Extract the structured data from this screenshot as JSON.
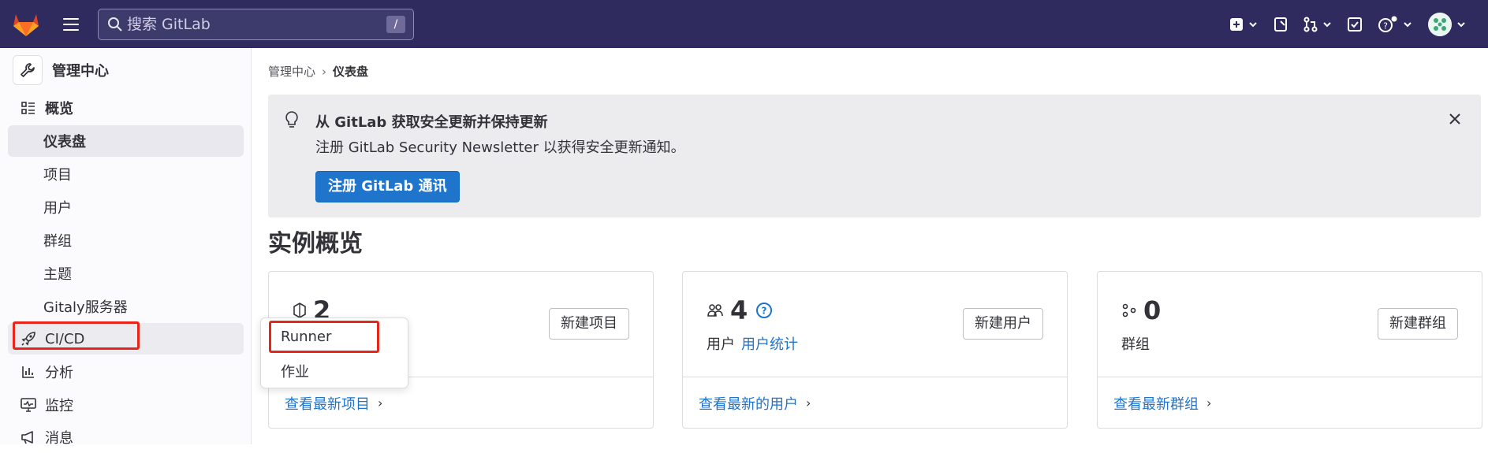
{
  "topbar": {
    "search_placeholder": "搜索 GitLab",
    "search_shortcut": "/",
    "icons": [
      "plus-square-icon",
      "issues-icon",
      "merge-request-icon",
      "todo-icon",
      "help-icon",
      "user-avatar"
    ]
  },
  "sidebar": {
    "title": "管理中心",
    "items": [
      {
        "label": "概览",
        "icon": "overview-icon"
      },
      {
        "label": "仪表盘"
      },
      {
        "label": "项目"
      },
      {
        "label": "用户"
      },
      {
        "label": "群组"
      },
      {
        "label": "主题"
      },
      {
        "label": "Gitaly服务器"
      },
      {
        "label": "CI/CD",
        "icon": "rocket-icon"
      },
      {
        "label": "分析",
        "icon": "chart-icon"
      },
      {
        "label": "监控",
        "icon": "monitor-icon"
      },
      {
        "label": "消息",
        "icon": "bullhorn-icon"
      }
    ]
  },
  "flyout": {
    "items": [
      "Runner",
      "作业"
    ]
  },
  "breadcrumb": {
    "parent": "管理中心",
    "current": "仪表盘"
  },
  "banner": {
    "title": "从 GitLab 获取安全更新并保持更新",
    "description": "注册 GitLab Security Newsletter 以获得安全更新通知。",
    "button": "注册 GitLab 通讯"
  },
  "section_title": "实例概览",
  "cards": [
    {
      "count": "2",
      "label": "",
      "link": "",
      "button": "新建项目",
      "footer": "查看最新项目"
    },
    {
      "count": "4",
      "label": "用户",
      "link": "用户统计",
      "button": "新建用户",
      "footer": "查看最新的用户"
    },
    {
      "count": "0",
      "label": "群组",
      "link": "",
      "button": "新建群组",
      "footer": "查看最新群组"
    }
  ],
  "colors": {
    "topbar": "#2f2b5f",
    "link": "#1f75cb",
    "highlight": "#e8251a"
  }
}
